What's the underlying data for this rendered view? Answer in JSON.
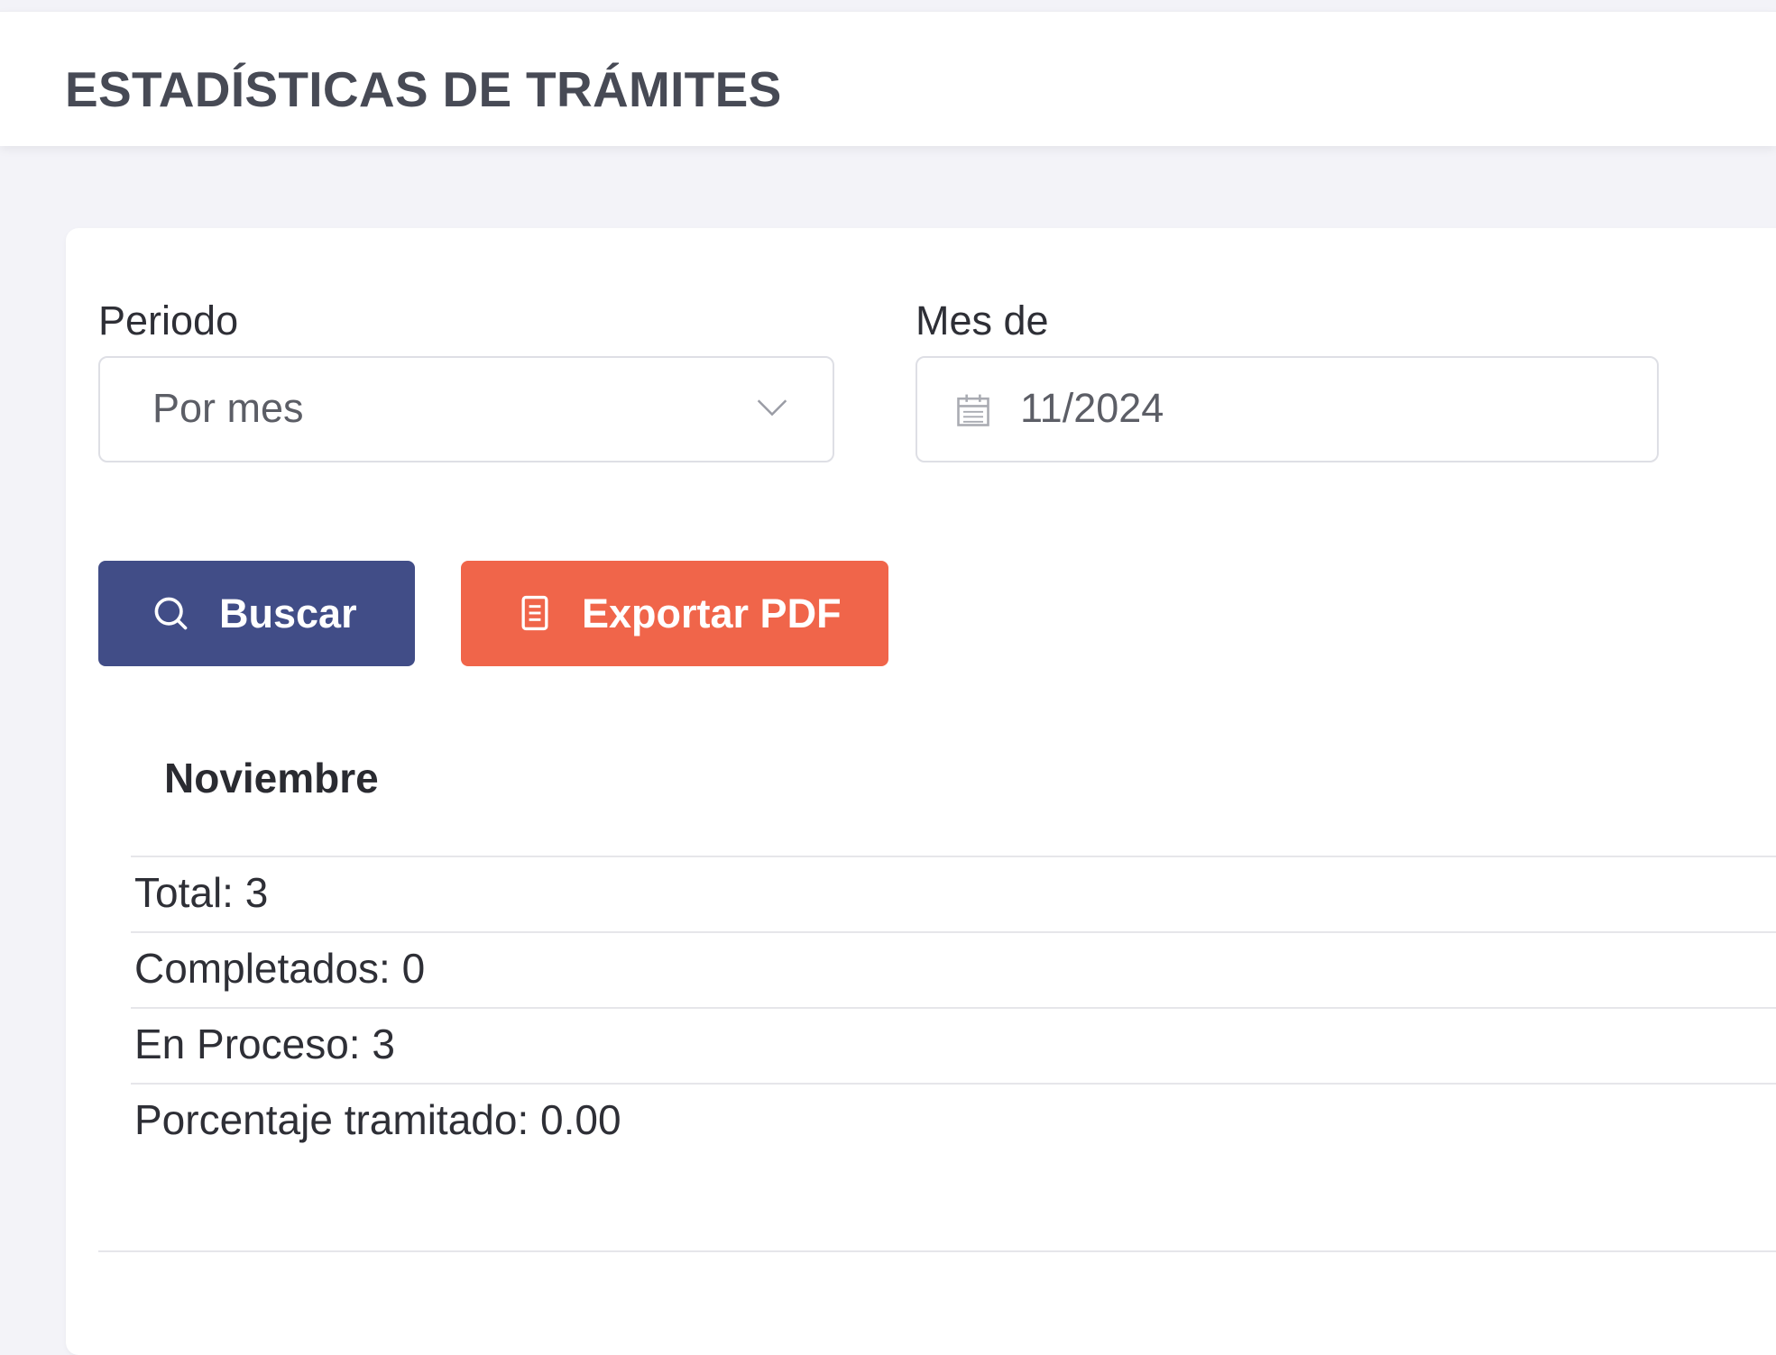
{
  "header": {
    "title": "ESTADÍSTICAS DE TRÁMITES"
  },
  "filters": {
    "period_label": "Periodo",
    "period_value": "Por mes",
    "month_label": "Mes de",
    "month_value": "11/2024"
  },
  "actions": {
    "search_label": "Buscar",
    "export_label": "Exportar PDF"
  },
  "results": {
    "month_title": "Noviembre",
    "rows": [
      "Total: 3",
      "Completados: 0",
      "En Proceso: 3",
      "Porcentaje tramitado: 0.00"
    ]
  },
  "colors": {
    "search_button": "#414d87",
    "export_button": "#f0654a"
  },
  "icons": {
    "period_dropdown": "chevron-down-icon",
    "month_field": "calendar-icon",
    "search_button": "search-icon",
    "export_button": "document-icon"
  }
}
